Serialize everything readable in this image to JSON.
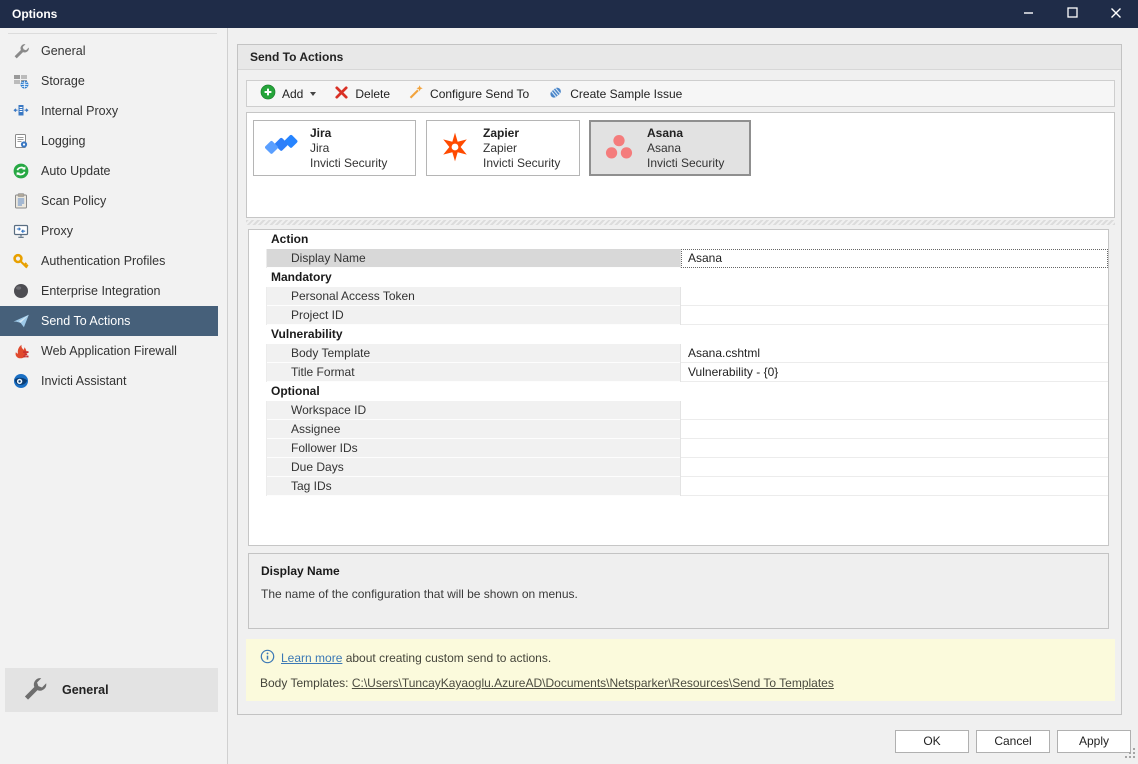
{
  "window": {
    "title": "Options"
  },
  "sidebar": {
    "items": [
      {
        "label": "General",
        "icon": "wrench-icon",
        "selected": false
      },
      {
        "label": "Storage",
        "icon": "storage-icon",
        "selected": false
      },
      {
        "label": "Internal Proxy",
        "icon": "proxy-server-icon",
        "selected": false
      },
      {
        "label": "Logging",
        "icon": "log-document-icon",
        "selected": false
      },
      {
        "label": "Auto Update",
        "icon": "refresh-icon",
        "selected": false
      },
      {
        "label": "Scan Policy",
        "icon": "clipboard-icon",
        "selected": false
      },
      {
        "label": "Proxy",
        "icon": "monitor-icon",
        "selected": false
      },
      {
        "label": "Authentication Profiles",
        "icon": "key-icon",
        "selected": false
      },
      {
        "label": "Enterprise Integration",
        "icon": "sphere-icon",
        "selected": false
      },
      {
        "label": "Send To Actions",
        "icon": "paper-plane-icon",
        "selected": true
      },
      {
        "label": "Web Application Firewall",
        "icon": "firewall-icon",
        "selected": false
      },
      {
        "label": "Invicti Assistant",
        "icon": "assistant-icon",
        "selected": false
      }
    ],
    "footer": {
      "label": "General",
      "icon": "wrench-icon"
    }
  },
  "panel": {
    "title": "Send To Actions",
    "toolbar": {
      "add": "Add",
      "delete": "Delete",
      "configure": "Configure Send To",
      "create_sample": "Create Sample Issue"
    },
    "cards": [
      {
        "title": "Jira",
        "name": "Jira",
        "vendor": "Invicti Security",
        "selected": false
      },
      {
        "title": "Zapier",
        "name": "Zapier",
        "vendor": "Invicti Security",
        "selected": false
      },
      {
        "title": "Asana",
        "name": "Asana",
        "vendor": "Invicti Security",
        "selected": true
      }
    ],
    "properties": {
      "rows": [
        {
          "type": "category",
          "label": "Action"
        },
        {
          "type": "item",
          "label": "Display Name",
          "value": "Asana",
          "selected": true
        },
        {
          "type": "category",
          "label": "Mandatory"
        },
        {
          "type": "item",
          "label": "Personal Access Token",
          "value": ""
        },
        {
          "type": "item",
          "label": "Project ID",
          "value": ""
        },
        {
          "type": "category",
          "label": "Vulnerability"
        },
        {
          "type": "item",
          "label": "Body Template",
          "value": "Asana.cshtml"
        },
        {
          "type": "item",
          "label": "Title Format",
          "value": "Vulnerability - {0}"
        },
        {
          "type": "category",
          "label": "Optional"
        },
        {
          "type": "item",
          "label": "Workspace ID",
          "value": ""
        },
        {
          "type": "item",
          "label": "Assignee",
          "value": ""
        },
        {
          "type": "item",
          "label": "Follower IDs",
          "value": ""
        },
        {
          "type": "item",
          "label": "Due Days",
          "value": ""
        },
        {
          "type": "item",
          "label": "Tag IDs",
          "value": ""
        }
      ]
    },
    "description": {
      "title": "Display Name",
      "text": "The name of the configuration that will be shown on menus."
    },
    "info": {
      "learn_more": "Learn more",
      "learn_more_suffix": " about creating custom send to actions.",
      "body_templates_label": "Body Templates:",
      "body_templates_path": "C:\\Users\\TuncayKayaoglu.AzureAD\\Documents\\Netsparker\\Resources\\Send To Templates"
    }
  },
  "footer_buttons": {
    "ok": "OK",
    "cancel": "Cancel",
    "apply": "Apply"
  },
  "colors": {
    "titlebar": "#1f2c48",
    "sidebar_selection": "#46607a",
    "info_background": "#fbfadc",
    "link_blue": "#3b78b5",
    "jira_blue": "#2684ff",
    "zapier_orange": "#ff4a00",
    "asana_salmon": "#f47c7c",
    "add_green": "#25a53a",
    "delete_red": "#d93025",
    "wand_orange": "#f2a33c"
  }
}
